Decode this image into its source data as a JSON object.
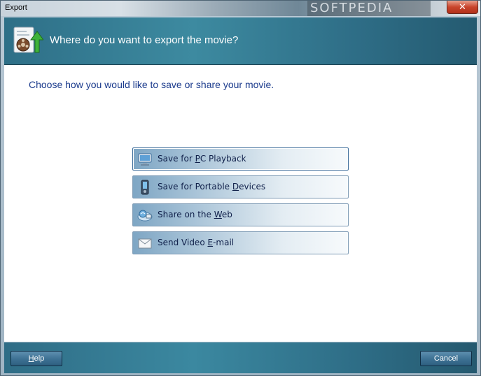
{
  "window": {
    "title": "Export",
    "watermark": "SOFTPEDIA",
    "close_label": "✕"
  },
  "header": {
    "heading": "Where do you want to export the movie?"
  },
  "main": {
    "prompt": "Choose how you would like to save or share your movie.",
    "options": [
      {
        "pre": "Save for ",
        "key": "P",
        "post": "C Playback",
        "icon": "pc-monitor-icon"
      },
      {
        "pre": "Save for Portable ",
        "key": "D",
        "post": "evices",
        "icon": "portable-device-icon"
      },
      {
        "pre": "Share on the ",
        "key": "W",
        "post": "eb",
        "icon": "web-share-icon"
      },
      {
        "pre": "Send Video ",
        "key": "E",
        "post": "-mail",
        "icon": "envelope-icon"
      }
    ]
  },
  "footer": {
    "help": {
      "key": "H",
      "rest": "elp"
    },
    "cancel": "Cancel"
  }
}
